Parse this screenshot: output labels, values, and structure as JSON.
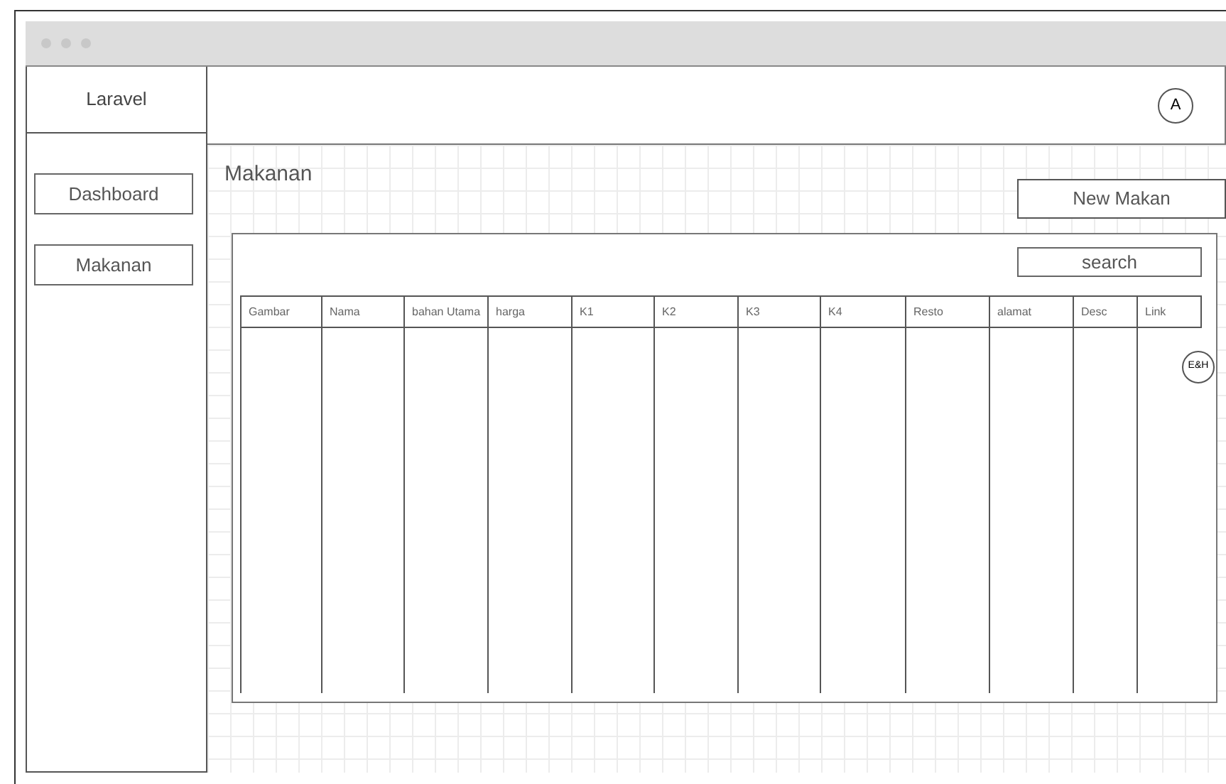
{
  "sidebar": {
    "brand": "Laravel",
    "items": [
      {
        "label": "Dashboard"
      },
      {
        "label": "Makanan"
      }
    ]
  },
  "header": {
    "avatar": "A"
  },
  "page": {
    "title": "Makanan",
    "new_button": "New Makan"
  },
  "table": {
    "search": {
      "placeholder": "search"
    },
    "columns": [
      "Gambar",
      "Nama",
      "bahan Utama",
      "harga",
      "K1",
      "K2",
      "K3",
      "K4",
      "Resto",
      "alamat",
      "Desc",
      "Link"
    ],
    "row_action": "E&H"
  }
}
